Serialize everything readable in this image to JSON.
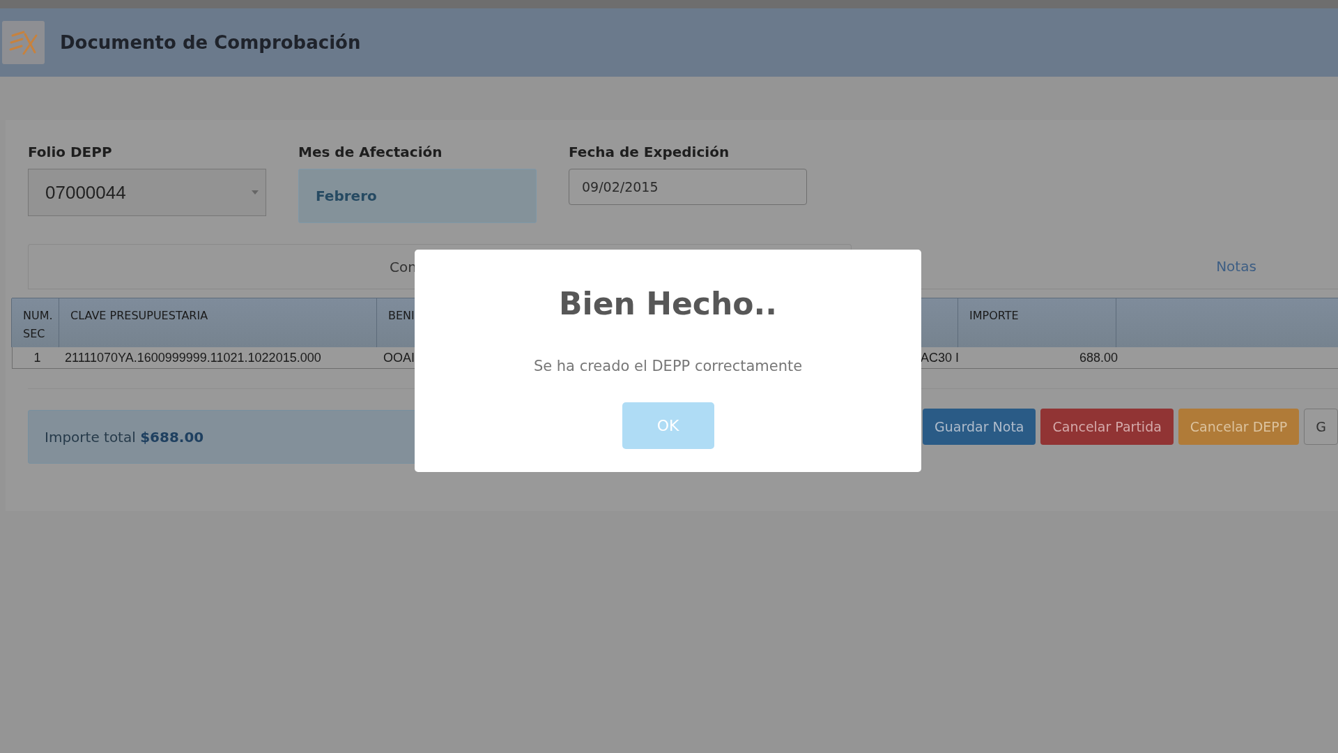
{
  "header": {
    "title": "Documento de Comprobación"
  },
  "form": {
    "folio": {
      "label": "Folio DEPP",
      "value": "07000044"
    },
    "mes": {
      "label": "Mes de Afectación",
      "value": "Febrero"
    },
    "fecha": {
      "label": "Fecha de Expedición",
      "value": "09/02/2015"
    }
  },
  "tabs": [
    {
      "label": "Con",
      "selected": true
    },
    {
      "label": "Notas",
      "selected": false
    }
  ],
  "table": {
    "columns": [
      "NUM. SEC",
      "CLAVE PRESUPUESTARIA",
      "BENI",
      "",
      "IMPORTE"
    ],
    "rows": [
      [
        "1",
        "21111070YA.1600999999.11021.1022015.000",
        "OOAI",
        "AC30 I",
        "688.00"
      ]
    ]
  },
  "total": {
    "text": "Importe total **$688.00**"
  },
  "buttons": [
    {
      "label": "Guardar Nota",
      "kind": "primary"
    },
    {
      "label": "Cancelar Partida",
      "kind": "danger"
    },
    {
      "label": "Cancelar DEPP",
      "kind": "warning"
    },
    {
      "label": "G",
      "kind": "default"
    }
  ],
  "modal": {
    "title": "Bien Hecho..",
    "message": "Se ha creado el DEPP correctamente",
    "button": "OK"
  }
}
